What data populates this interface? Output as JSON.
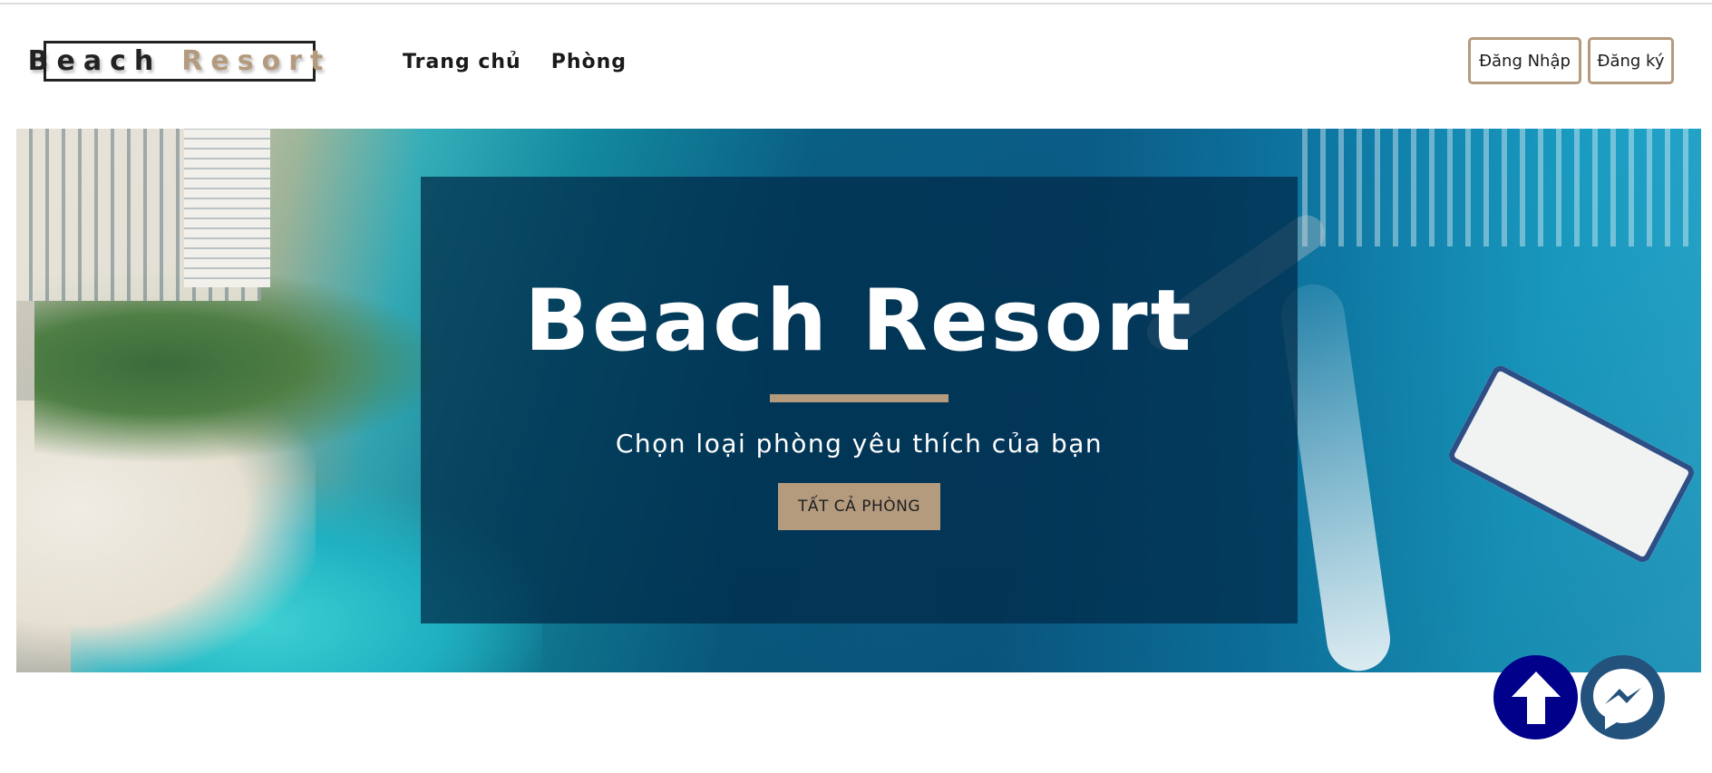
{
  "header": {
    "logo": {
      "word1": "Beach",
      "word2": "Resort"
    },
    "nav": [
      {
        "label": "Trang chủ"
      },
      {
        "label": "Phòng"
      }
    ],
    "login_label": "Đăng Nhập",
    "signup_label": "Đăng ký"
  },
  "hero": {
    "title": "Beach Resort",
    "subtitle": "Chọn loại phòng yêu thích của bạn",
    "cta_label": "TẤT CẢ PHÒNG"
  },
  "floating": {
    "scroll_top_icon": "arrow-up-icon",
    "messenger_icon": "messenger-icon"
  },
  "colors": {
    "accent": "#b49b7e",
    "overlay": "#00283f",
    "scroll_top_bg": "#00008b",
    "messenger_bg": "#23527c"
  }
}
